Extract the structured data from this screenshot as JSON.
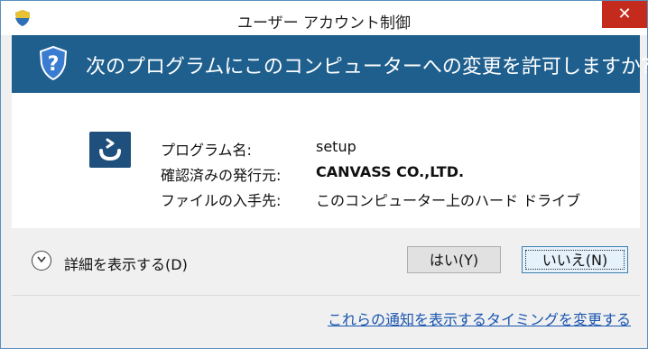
{
  "window": {
    "title": "ユーザー アカウント制御",
    "close_label": "✕"
  },
  "banner": {
    "question": "次のプログラムにこのコンピューターへの変更を許可しますか?"
  },
  "details": {
    "program_label": "プログラム名:",
    "program_value": "setup",
    "publisher_label": "確認済みの発行元:",
    "publisher_value": "CANVASS CO.,LTD.",
    "origin_label": "ファイルの入手先:",
    "origin_value": "このコンピューター上のハード ドライブ"
  },
  "actions": {
    "show_details_label": "詳細を表示する(D)",
    "yes_label": "はい(Y)",
    "no_label": "いいえ(N)"
  },
  "footer": {
    "notification_link": "これらの通知を表示するタイミングを変更する"
  },
  "colors": {
    "banner_bg": "#1f5f8e",
    "close_bg": "#c42b1c",
    "link": "#1a56b0"
  }
}
